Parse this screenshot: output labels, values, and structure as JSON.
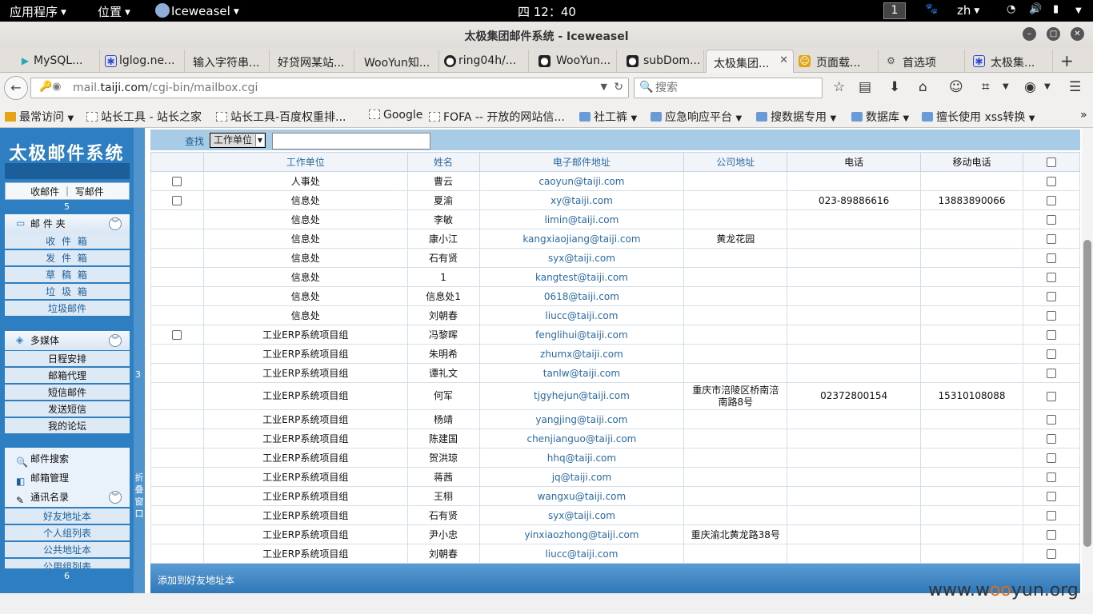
{
  "topbar": {
    "apps_menu": "应用程序",
    "places_menu": "位置",
    "active_app": "Iceweasel",
    "clock": "四 12：40",
    "workspace": "1",
    "lang": "zh"
  },
  "window": {
    "title": "太极集团邮件系统 - Iceweasel"
  },
  "tabs": [
    {
      "label": "MySQL..."
    },
    {
      "label": "lglog.ne..."
    },
    {
      "label": "输入字符串..."
    },
    {
      "label": "好贷网某站..."
    },
    {
      "label": "WooYun知..."
    },
    {
      "label": "ring04h/..."
    },
    {
      "label": "WooYun..."
    },
    {
      "label": "subDom..."
    },
    {
      "label": "太极集团..."
    },
    {
      "label": "页面载..."
    },
    {
      "label": "首选项"
    },
    {
      "label": "太极集..."
    }
  ],
  "nav": {
    "url_host": "mail.taiji.com",
    "url_path": "/cgi-bin/mailbox.cgi",
    "url_prefix": "mail.",
    "url_domain": "taiji.com",
    "search_placeholder": "搜索"
  },
  "bookmarks": [
    {
      "label": "最常访问",
      "icon": "star",
      "dropdown": true
    },
    {
      "label": "站长工具 - 站长之家",
      "icon": "page"
    },
    {
      "label": "站长工具-百度权重排...",
      "icon": "page"
    },
    {
      "label": "Google",
      "icon": "page"
    },
    {
      "label": "FOFA -- 开放的网站信...",
      "icon": "page"
    },
    {
      "label": "社工裤",
      "icon": "folder",
      "dropdown": true
    },
    {
      "label": "应急响应平台",
      "icon": "folder",
      "dropdown": true
    },
    {
      "label": "搜数据专用",
      "icon": "folder",
      "dropdown": true
    },
    {
      "label": "数据库",
      "icon": "folder",
      "dropdown": true
    },
    {
      "label": "擅长使用 xss转换",
      "icon": "folder",
      "dropdown": true
    }
  ],
  "sidebar": {
    "logo": "太极邮件系统",
    "mail_links": "收邮件 ｜ 写邮件",
    "num1": "5",
    "folder_header": "邮 件 夹",
    "folders": [
      "收 件 箱",
      "发 件 箱",
      "草 稿 箱",
      "垃 圾 箱",
      "垃圾邮件"
    ],
    "media_header": "多媒体",
    "media_items": [
      "日程安排",
      "邮箱代理",
      "短信邮件",
      "发送短信",
      "我的论坛"
    ],
    "search_item": "邮件搜索",
    "manage_item": "邮箱管理",
    "contacts_header": "通讯名录",
    "contacts_items": [
      "好友地址本",
      "个人组列表",
      "公共地址本",
      "公用组列表"
    ],
    "num2": "6"
  },
  "splitter": {
    "num": "3",
    "fold_label": "折叠窗口"
  },
  "find": {
    "label": "查找",
    "field": "工作单位",
    "value": ""
  },
  "table": {
    "headers": [
      "工作单位",
      "姓名",
      "电子邮件地址",
      "公司地址",
      "电话",
      "移动电话"
    ],
    "rows": [
      {
        "cb_left": true,
        "unit": "人事处",
        "name": "曹云",
        "email": "caoyun@taiji.com",
        "addr": "",
        "phone": "",
        "mobile": ""
      },
      {
        "cb_left": true,
        "unit": "信息处",
        "name": "夏渝",
        "email": "xy@taiji.com",
        "addr": "",
        "phone": "023-89886616",
        "mobile": "13883890066"
      },
      {
        "cb_left": false,
        "unit": "信息处",
        "name": "李敏",
        "email": "limin@taiji.com",
        "addr": "",
        "phone": "",
        "mobile": ""
      },
      {
        "cb_left": false,
        "unit": "信息处",
        "name": "康小江",
        "email": "kangxiaojiang@taiji.com",
        "addr": "黄龙花园",
        "phone": "",
        "mobile": ""
      },
      {
        "cb_left": false,
        "unit": "信息处",
        "name": "石有贤",
        "email": "syx@taiji.com",
        "addr": "",
        "phone": "",
        "mobile": ""
      },
      {
        "cb_left": false,
        "unit": "信息处",
        "name": "1",
        "email": "kangtest@taiji.com",
        "addr": "",
        "phone": "",
        "mobile": ""
      },
      {
        "cb_left": false,
        "unit": "信息处",
        "name": "信息处1",
        "email": "0618@taiji.com",
        "addr": "",
        "phone": "",
        "mobile": ""
      },
      {
        "cb_left": false,
        "unit": "信息处",
        "name": "刘朝春",
        "email": "liucc@taiji.com",
        "addr": "",
        "phone": "",
        "mobile": ""
      },
      {
        "cb_left": true,
        "unit": "工业ERP系统项目组",
        "name": "冯黎晖",
        "email": "fenglihui@taiji.com",
        "addr": "",
        "phone": "",
        "mobile": ""
      },
      {
        "cb_left": false,
        "unit": "工业ERP系统项目组",
        "name": "朱明希",
        "email": "zhumx@taiji.com",
        "addr": "",
        "phone": "",
        "mobile": ""
      },
      {
        "cb_left": false,
        "unit": "工业ERP系统项目组",
        "name": "谭礼文",
        "email": "tanlw@taiji.com",
        "addr": "",
        "phone": "",
        "mobile": ""
      },
      {
        "cb_left": false,
        "unit": "工业ERP系统项目组",
        "name": "何军",
        "email": "tjgyhejun@taiji.com",
        "addr": "重庆市涪陵区桥南涪南路8号",
        "phone": "02372800154",
        "mobile": "15310108088",
        "tall": true
      },
      {
        "cb_left": false,
        "unit": "工业ERP系统项目组",
        "name": "杨靖",
        "email": "yangjing@taiji.com",
        "addr": "",
        "phone": "",
        "mobile": ""
      },
      {
        "cb_left": false,
        "unit": "工业ERP系统项目组",
        "name": "陈建国",
        "email": "chenjianguo@taiji.com",
        "addr": "",
        "phone": "",
        "mobile": ""
      },
      {
        "cb_left": false,
        "unit": "工业ERP系统项目组",
        "name": "贺洪琼",
        "email": "hhq@taiji.com",
        "addr": "",
        "phone": "",
        "mobile": ""
      },
      {
        "cb_left": false,
        "unit": "工业ERP系统项目组",
        "name": "蒋茜",
        "email": "jq@taiji.com",
        "addr": "",
        "phone": "",
        "mobile": ""
      },
      {
        "cb_left": false,
        "unit": "工业ERP系统项目组",
        "name": "王栩",
        "email": "wangxu@taiji.com",
        "addr": "",
        "phone": "",
        "mobile": ""
      },
      {
        "cb_left": false,
        "unit": "工业ERP系统项目组",
        "name": "石有贤",
        "email": "syx@taiji.com",
        "addr": "",
        "phone": "",
        "mobile": ""
      },
      {
        "cb_left": false,
        "unit": "工业ERP系统项目组",
        "name": "尹小忠",
        "email": "yinxiaozhong@taiji.com",
        "addr": "重庆渝北黄龙路38号",
        "phone": "",
        "mobile": ""
      },
      {
        "cb_left": false,
        "unit": "工业ERP系统项目组",
        "name": "刘朝春",
        "email": "liucc@taiji.com",
        "addr": "",
        "phone": "",
        "mobile": ""
      }
    ]
  },
  "footer": {
    "action": "添加到好友地址本"
  },
  "watermark": {
    "pre": "www.w",
    "o": "oo",
    "post": "yun.org"
  }
}
